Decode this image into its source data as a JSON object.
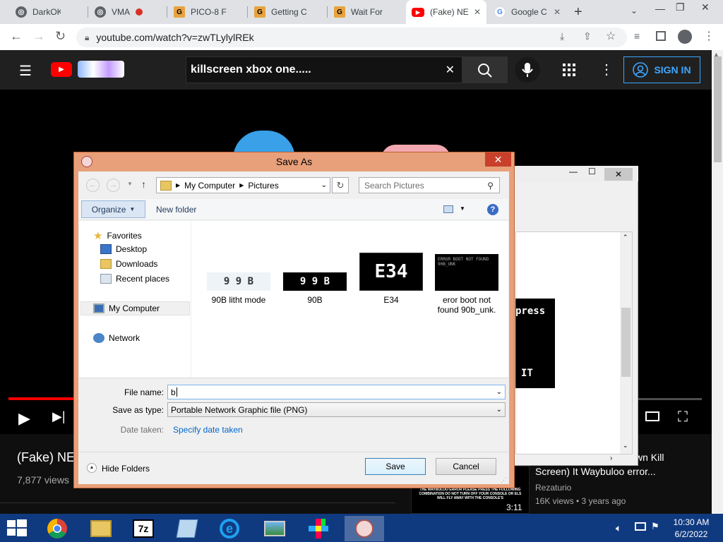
{
  "browser": {
    "tabs": [
      {
        "title": "DarkOK",
        "icon": "globe-icon",
        "color": "#5f6368"
      },
      {
        "title": "VMA",
        "icon": "globe-icon",
        "color": "#5f6368"
      },
      {
        "title": "PICO-8 F",
        "icon": "g-logo-icon",
        "color": "#e8a33d"
      },
      {
        "title": "Getting C",
        "icon": "g-logo-icon",
        "color": "#e8a33d"
      },
      {
        "title": "Wait For",
        "icon": "g-logo-icon",
        "color": "#e8a33d"
      },
      {
        "title": "(Fake) NE",
        "icon": "youtube-icon",
        "color": "#ff0000"
      },
      {
        "title": "Google C",
        "icon": "google-icon",
        "color": "#4285f4"
      }
    ],
    "url": "youtube.com/watch?v=zwTLylylREk"
  },
  "youtube": {
    "search_value": "killscreen xbox one.....",
    "sign_in": "SIGN IN",
    "video_title": "(Fake) NE",
    "views": "7,877 views",
    "side_title_1": "wn Kill",
    "side_title_2": "Screen) It Waybuloo error...",
    "side_channel": "Rezaturio",
    "side_meta": "16K views • 3 years ago",
    "side_duration": "3:11",
    "side_thumb_text": "THE WAYBULOO ERROR PLEASE PRESS THE FOLLOWING COMBINATION DO NOT TURN OFF YOUR CONSOLE OR ELS WILL FLY AWAY WITH THE CONSOLE'S",
    "bg_text_1": "press",
    "bg_text_2": "IT"
  },
  "dialog": {
    "title": "Save As",
    "breadcrumb": [
      "My Computer",
      "Pictures"
    ],
    "search_placeholder": "Search Pictures",
    "organize": "Organize",
    "new_folder": "New folder",
    "nav": {
      "favorites": "Favorites",
      "desktop": "Desktop",
      "downloads": "Downloads",
      "recent": "Recent places",
      "computer": "My Computer",
      "network": "Network"
    },
    "files": [
      {
        "name": "90B litht mode",
        "thumb": "9 9 B"
      },
      {
        "name": "90B",
        "thumb": "9 9 B"
      },
      {
        "name": "E34",
        "thumb": "E34"
      },
      {
        "name": "eror boot not found 90b_unk.",
        "thumb": "ERROR BOOT NOT FOUND 90B_UNK"
      }
    ],
    "file_name_label": "File name:",
    "file_name_value": "b",
    "save_type_label": "Save as type:",
    "save_type_value": "Portable Network Graphic file (PNG)",
    "date_label": "Date taken:",
    "date_link": "Specify date taken",
    "hide_folders": "Hide Folders",
    "save": "Save",
    "cancel": "Cancel"
  },
  "taskbar": {
    "time": "10:30 AM",
    "date": "6/2/2022"
  }
}
